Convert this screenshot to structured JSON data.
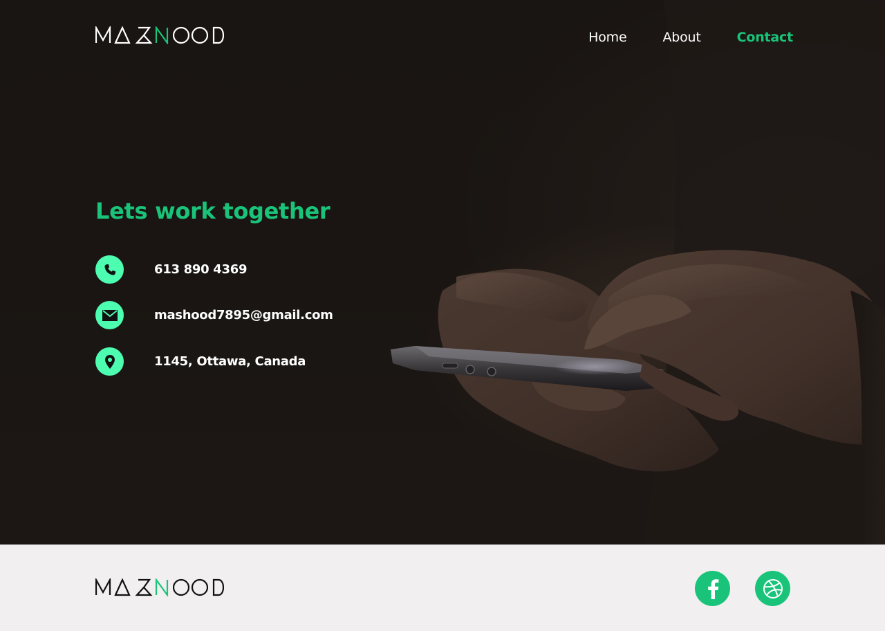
{
  "brand": {
    "name": "MASHOOD",
    "accent_color": "#19c47a",
    "icon_color": "#4dfdb0"
  },
  "nav": {
    "items": [
      {
        "label": "Home",
        "active": false
      },
      {
        "label": "About",
        "active": false
      },
      {
        "label": "Contact",
        "active": true
      }
    ]
  },
  "hero": {
    "headline": "Lets work together",
    "contacts": [
      {
        "icon": "phone-icon",
        "text": "613 890 4369"
      },
      {
        "icon": "mail-icon",
        "text": "mashood7895@gmail.com"
      },
      {
        "icon": "location-pin-icon",
        "text": "1145, Ottawa, Canada"
      }
    ],
    "background_image": "hands-holding-smartphone-photo"
  },
  "footer": {
    "social": [
      {
        "icon": "facebook-icon"
      },
      {
        "icon": "dribbble-icon"
      }
    ]
  }
}
